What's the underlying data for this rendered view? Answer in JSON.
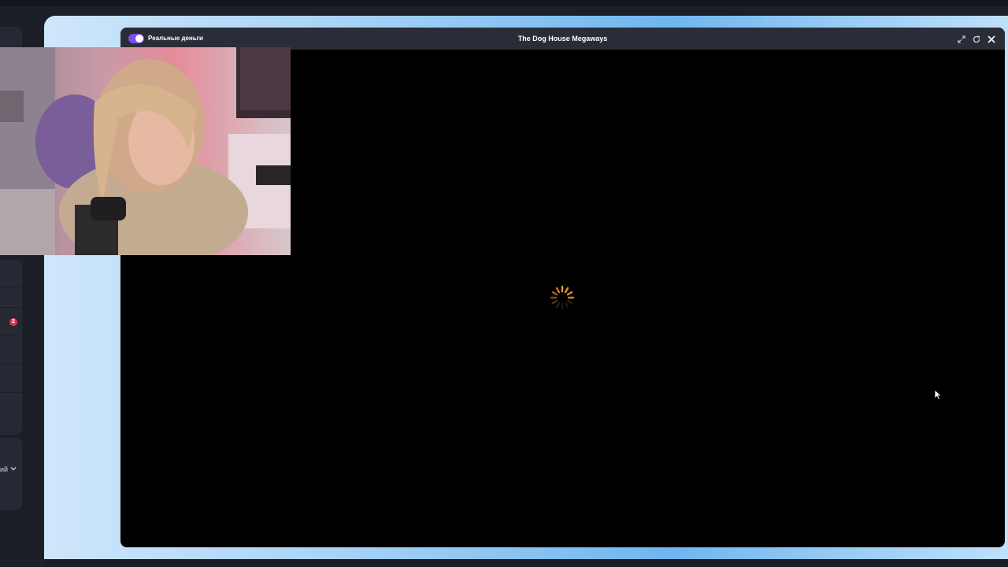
{
  "modal": {
    "mode_toggle_label": "Реальные деньги",
    "title": "The Dog House Megaways",
    "icons": [
      "expand-icon",
      "reload-icon",
      "close-icon"
    ]
  },
  "sidebar": {
    "notification_count": "2",
    "language_label_partial": "ий"
  },
  "colors": {
    "toggle_accent": "#7b4df0",
    "badge": "#e8334a",
    "spinner": "#f29a2e",
    "backdrop_blue": "#6fb6ef"
  }
}
